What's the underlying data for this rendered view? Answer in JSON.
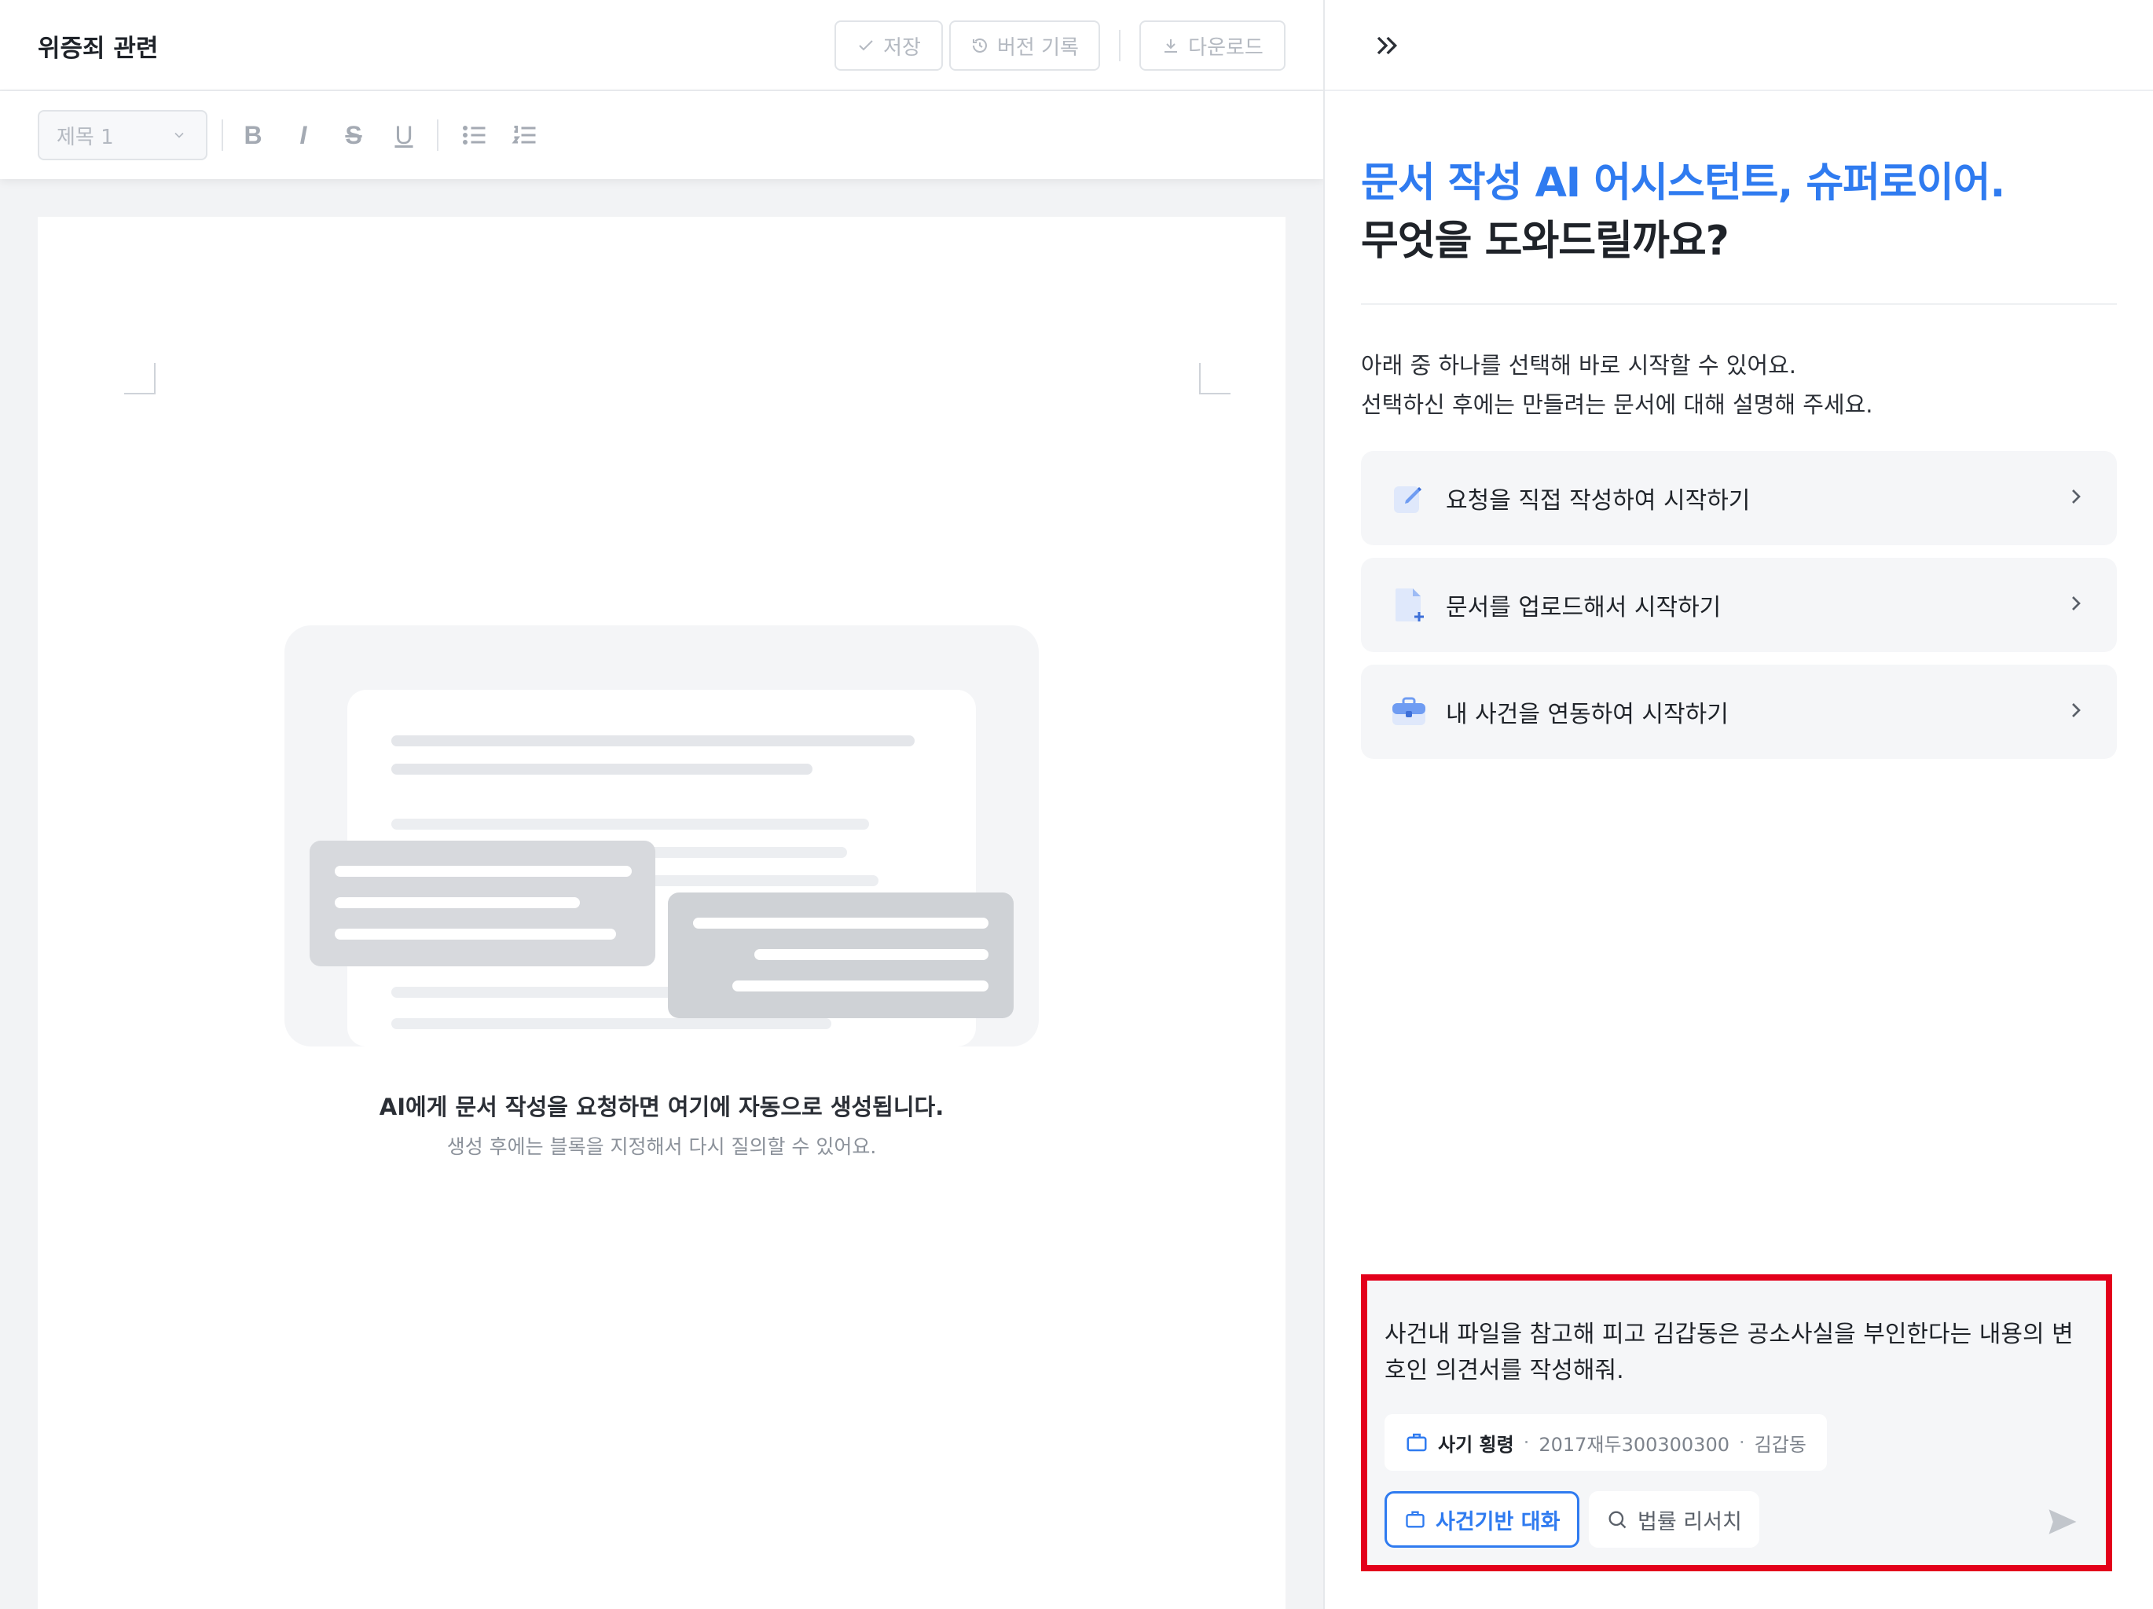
{
  "editor": {
    "doc_title": "위증죄 관련",
    "save_label": "저장",
    "history_label": "버전 기록",
    "download_label": "다운로드",
    "heading_select_value": "제목 1",
    "format_buttons": {
      "bold": "B",
      "italic": "I",
      "strike": "S",
      "underline": "U"
    },
    "empty_state": {
      "title": "AI에게 문서 작성을 요청하면 여기에 자동으로 생성됩니다.",
      "subtitle": "생성 후에는 블록을 지정해서 다시 질의할 수 있어요."
    }
  },
  "assistant": {
    "headline_blue": "문서 작성 AI 어시스턴트, 슈퍼로이어.",
    "headline_dark": "무엇을 도와드릴까요?",
    "intro_line1": "아래 중 하나를 선택해 바로 시작할 수 있어요.",
    "intro_line2": "선택하신 후에는 만들려는 문서에 대해 설명해 주세요.",
    "options": [
      {
        "label": "요청을 직접 작성하여 시작하기",
        "icon": "pencil-note-icon"
      },
      {
        "label": "문서를 업로드해서 시작하기",
        "icon": "file-add-icon"
      },
      {
        "label": "내 사건을 연동하여 시작하기",
        "icon": "briefcase-icon"
      }
    ],
    "composer": {
      "prompt_text": "사건내 파일을 참고해 피고 김갑동은 공소사실을 부인한다는 내용의 변호인 의견서를 작성해줘.",
      "case_chip": {
        "name": "사기 횡령",
        "separator": "·",
        "case_number": "2017재두300300300",
        "party": "김갑동"
      },
      "mode_case_label": "사건기반 대화",
      "mode_research_label": "법률 리서치"
    }
  },
  "colors": {
    "accent": "#2f7bf0",
    "highlight_border": "#e3001b",
    "panel_bg": "#f5f6f8"
  }
}
